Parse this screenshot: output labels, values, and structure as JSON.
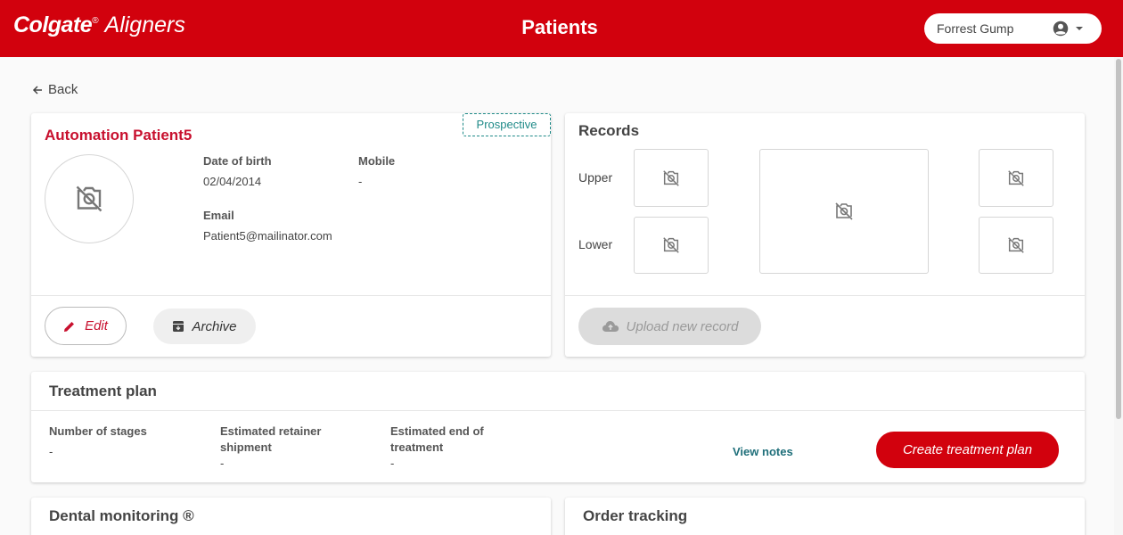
{
  "header": {
    "brand": "Colgate",
    "brand_sub": "Aligners",
    "brand_mark": "®",
    "title": "Patients",
    "user_name": "Forrest Gump",
    "user_icon": "account-circle-icon",
    "caret_icon": "caret-down-icon",
    "bar_color": "#d2010d"
  },
  "nav": {
    "back_label": "Back"
  },
  "patient": {
    "name": "Automation Patient5",
    "status": "Prospective",
    "dob_label": "Date of birth",
    "dob": "02/04/2014",
    "mobile_label": "Mobile",
    "mobile": "-",
    "email_label": "Email",
    "email": "Patient5@mailinator.com",
    "edit_label": "Edit",
    "archive_label": "Archive"
  },
  "records": {
    "title": "Records",
    "upper_label": "Upper",
    "lower_label": "Lower",
    "upload_label": "Upload new record",
    "placeholder_icon": "no-photo-icon"
  },
  "treatment": {
    "title": "Treatment plan",
    "stages_label": "Number of stages",
    "stages_value": "-",
    "retainer_label_line1": "Estimated retainer",
    "retainer_label_line2": "shipment",
    "retainer_value": "-",
    "end_label_line1": "Estimated end of",
    "end_label_line2": "treatment",
    "end_value": "-",
    "view_notes": "View notes",
    "create_label": "Create treatment plan"
  },
  "dental_monitoring": {
    "title": "Dental monitoring ®"
  },
  "order_tracking": {
    "title": "Order tracking"
  },
  "colors": {
    "accent": "#d2010d",
    "status": "#1f8a88",
    "link": "#1f6f7a"
  }
}
